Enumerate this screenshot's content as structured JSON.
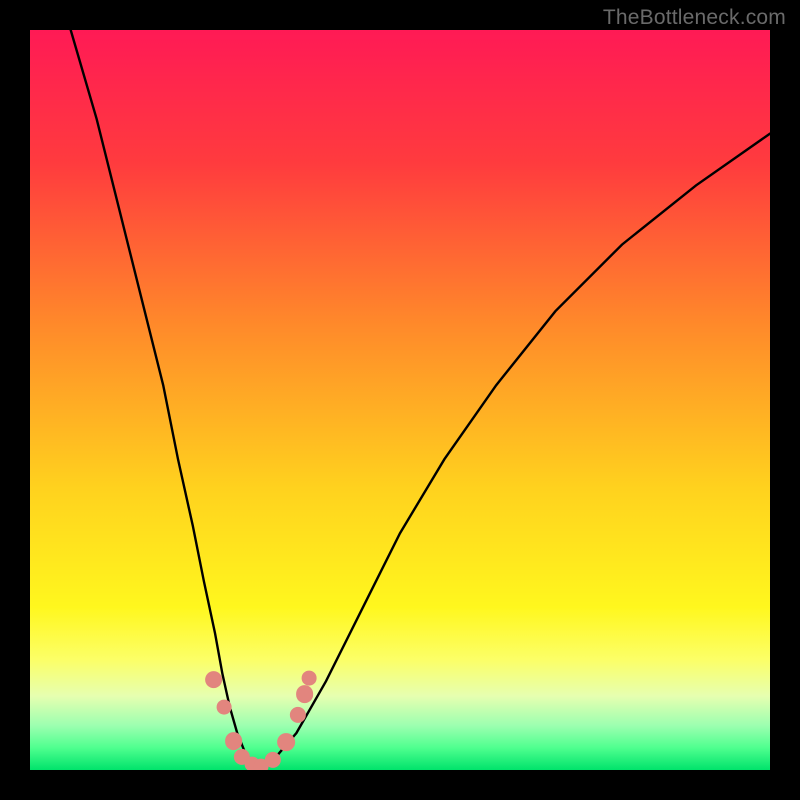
{
  "watermark": "TheBottleneck.com",
  "chart_data": {
    "type": "line",
    "title": "",
    "xlabel": "",
    "ylabel": "",
    "xlim": [
      0,
      100
    ],
    "ylim": [
      0,
      100
    ],
    "grid": false,
    "legend": false,
    "gradient_stops": [
      {
        "offset": 0,
        "color": "#ff1a55"
      },
      {
        "offset": 18,
        "color": "#ff3b3e"
      },
      {
        "offset": 40,
        "color": "#ff8a2a"
      },
      {
        "offset": 62,
        "color": "#ffd21e"
      },
      {
        "offset": 78,
        "color": "#fff71e"
      },
      {
        "offset": 85,
        "color": "#fcff66"
      },
      {
        "offset": 90,
        "color": "#e6ffb0"
      },
      {
        "offset": 94,
        "color": "#9cffb0"
      },
      {
        "offset": 97,
        "color": "#4fff8f"
      },
      {
        "offset": 100,
        "color": "#00e36b"
      }
    ],
    "green_band": {
      "from_y": 93,
      "to_y": 100
    },
    "left_curve_x": [
      5.5,
      9,
      12,
      15,
      18,
      20,
      22,
      23.5,
      25,
      26,
      27,
      28,
      29,
      30,
      31
    ],
    "left_curve_y": [
      100,
      88,
      76,
      64,
      52,
      42,
      33,
      25.5,
      18.5,
      13,
      8.5,
      5,
      2.5,
      1,
      0.3
    ],
    "right_curve_x": [
      31,
      33,
      36,
      40,
      45,
      50,
      56,
      63,
      71,
      80,
      90,
      100
    ],
    "right_curve_y": [
      0.3,
      1.5,
      5,
      12,
      22,
      32,
      42,
      52,
      62,
      71,
      79,
      86
    ],
    "scatter_points": [
      {
        "x": 24.8,
        "y": 12.2,
        "r": 1.2
      },
      {
        "x": 26.2,
        "y": 8.5,
        "r": 1.0
      },
      {
        "x": 27.5,
        "y": 3.9,
        "r": 1.2
      },
      {
        "x": 28.6,
        "y": 1.8,
        "r": 1.1
      },
      {
        "x": 30.0,
        "y": 0.8,
        "r": 1.0
      },
      {
        "x": 31.2,
        "y": 0.5,
        "r": 1.0
      },
      {
        "x": 32.8,
        "y": 1.4,
        "r": 1.1
      },
      {
        "x": 34.6,
        "y": 3.8,
        "r": 1.2
      },
      {
        "x": 36.2,
        "y": 7.5,
        "r": 1.1
      },
      {
        "x": 37.1,
        "y": 10.3,
        "r": 1.2
      },
      {
        "x": 37.7,
        "y": 12.4,
        "r": 1.0
      }
    ],
    "scatter_color": "#e2857e",
    "curve_color": "#000000",
    "curve_width": 2.4
  }
}
